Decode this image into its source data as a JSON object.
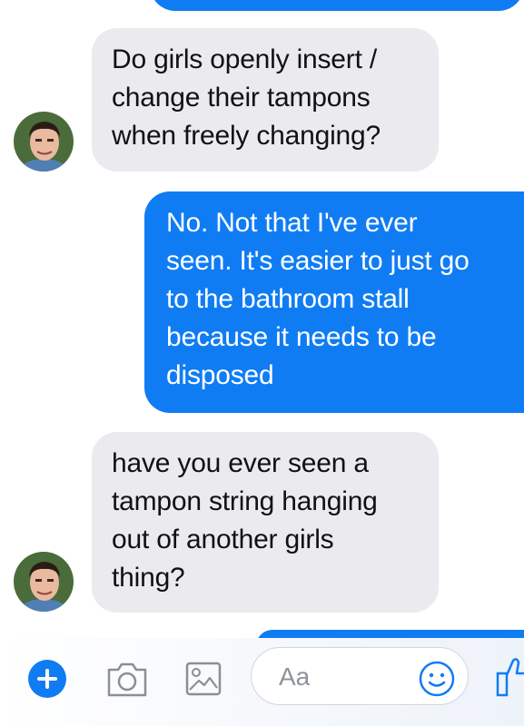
{
  "messages": [
    {
      "direction": "incoming",
      "lines": [
        "Do girls openly insert /",
        "change their tampons",
        "when freely changing?"
      ]
    },
    {
      "direction": "outgoing",
      "lines": [
        "No. Not that I've ever",
        "seen. It's easier to just go",
        "to the bathroom stall",
        "because it needs to be",
        "disposed"
      ]
    },
    {
      "direction": "incoming",
      "lines": [
        "have you ever seen a",
        "tampon string hanging",
        "out of another girls",
        "thing?"
      ]
    }
  ],
  "composer": {
    "placeholder": "Aa",
    "icons": [
      "plus-icon",
      "camera-icon",
      "gallery-icon",
      "emoji-icon",
      "thumbs-up-icon"
    ]
  },
  "colors": {
    "outgoing_bubble": "#0f7cf4",
    "incoming_bubble": "#ebebef",
    "accent": "#0f7cf4"
  }
}
